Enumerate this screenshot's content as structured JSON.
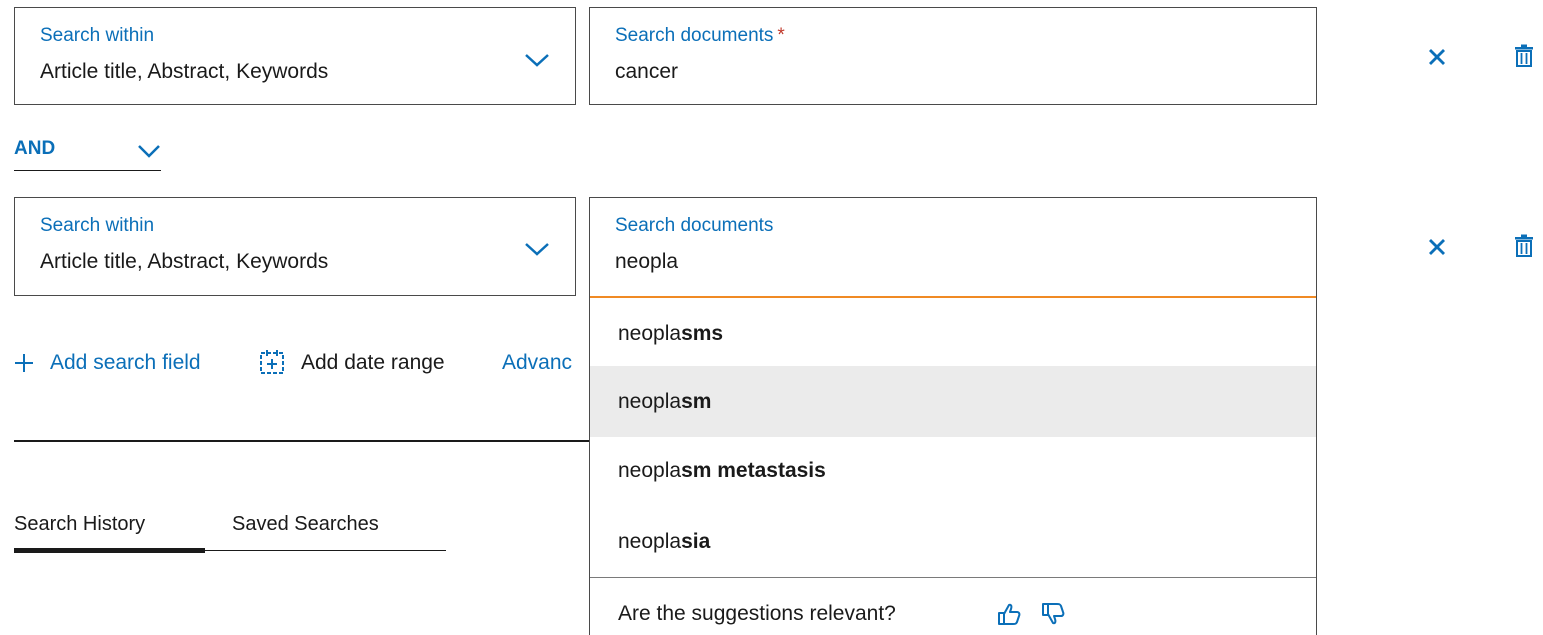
{
  "rows": [
    {
      "within_label": "Search within",
      "within_value": "Article title, Abstract, Keywords",
      "docs_label": "Search documents",
      "docs_required": "*",
      "docs_value": "cancer"
    },
    {
      "within_label": "Search within",
      "within_value": "Article title, Abstract, Keywords",
      "docs_label": "Search documents",
      "docs_value": "neopla"
    }
  ],
  "operator": {
    "label": "AND"
  },
  "actions": {
    "add_search_field": "Add search field",
    "add_date_range": "Add date range",
    "advanced": "Advanc"
  },
  "tabs": [
    {
      "label": "Search History",
      "active": true
    },
    {
      "label": "Saved Searches",
      "active": false
    }
  ],
  "suggestions": [
    {
      "prefix": "neopla",
      "rest": "sms"
    },
    {
      "prefix": "neopla",
      "rest": "sm",
      "highlighted": true
    },
    {
      "prefix": "neopla",
      "rest": "sm metastasis"
    },
    {
      "prefix": "neopla",
      "rest": "sia"
    }
  ],
  "feedback": {
    "question": "Are the suggestions relevant?"
  },
  "colors": {
    "accent": "#0b6fb8",
    "focus_border": "#f08a24",
    "required": "#c0392b",
    "highlight_bg": "#ebebeb"
  },
  "icons": [
    "chevron-down-icon",
    "close-icon",
    "trash-icon",
    "plus-icon",
    "calendar-add-icon",
    "thumbs-up-icon",
    "thumbs-down-icon"
  ]
}
